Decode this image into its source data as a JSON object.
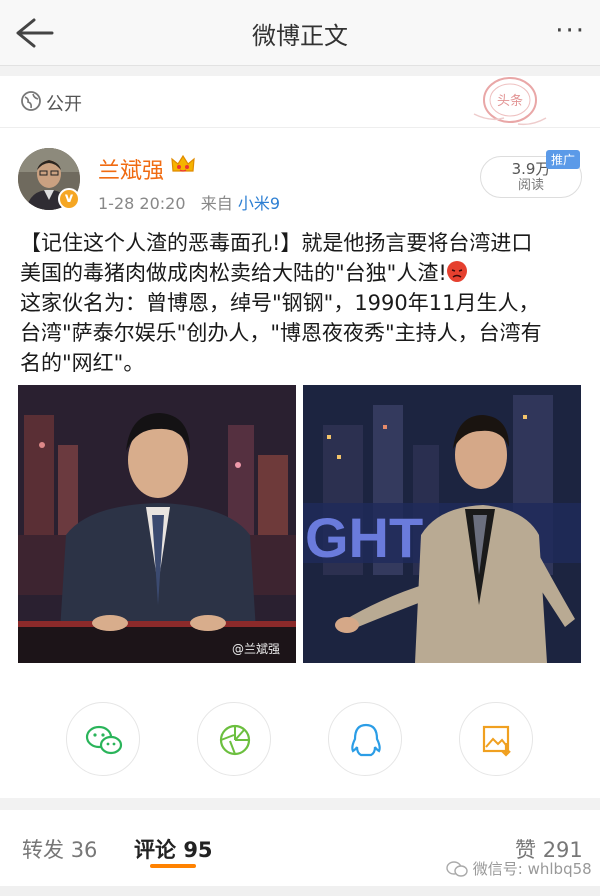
{
  "navbar": {
    "title": "微博正文",
    "more": "···"
  },
  "visibility": {
    "label": "公开"
  },
  "stamp": {
    "text": "头条"
  },
  "author": {
    "name": "兰斌强",
    "verified": "v",
    "timestamp": "1-28 20:20",
    "source_prefix": "来自",
    "source": "小米9"
  },
  "reads": {
    "count": "3.9万",
    "label": "阅读",
    "promo_tag": "推广"
  },
  "post": {
    "line1": "【记住这个人渣的恶毒面孔!】就是他扬言要将台湾进口",
    "line2": "美国的毒猪肉做成肉松卖给大陆的\"台独\"人渣!",
    "line3": "这家伙名为：曾博恩，绰号\"钢钢\"，1990年11月生人，",
    "line4": "台湾\"萨泰尔娱乐\"创办人，\"博恩夜夜秀\"主持人，台湾有",
    "line5": "名的\"网红\"。"
  },
  "images": {
    "watermark": "@兰斌强",
    "sign_text": "GHT"
  },
  "share": {
    "icons": [
      "wechat-icon",
      "moments-icon",
      "qq-icon",
      "save-image-icon"
    ]
  },
  "tabs": {
    "repost_label": "转发",
    "repost_count": "36",
    "comment_label": "评论",
    "comment_count": "95",
    "like_label": "赞",
    "like_count": "291"
  },
  "wechat_watermark": "微信号: whlbq58",
  "colors": {
    "accent": "#ff8200",
    "username": "#f06b12",
    "link": "#2d7fd3"
  }
}
